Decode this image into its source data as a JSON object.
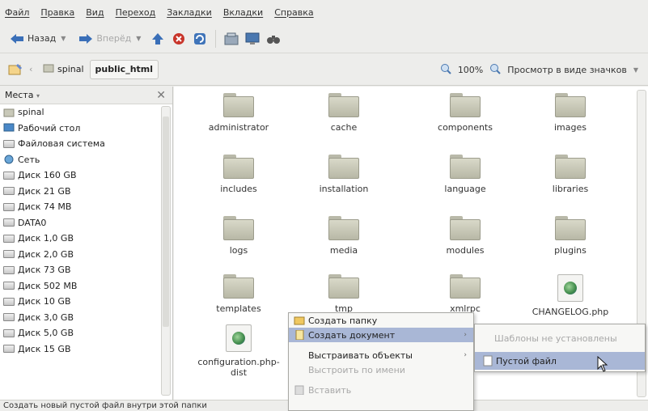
{
  "menubar": [
    "Файл",
    "Правка",
    "Вид",
    "Переход",
    "Закладки",
    "Вкладки",
    "Справка"
  ],
  "toolbar": {
    "back_label": "Назад",
    "forward_label": "Вперёд"
  },
  "location": {
    "crumbs": [
      "spinal",
      "public_html"
    ],
    "zoom": "100%",
    "view_mode": "Просмотр в виде значков"
  },
  "sidebar": {
    "title": "Места",
    "items": [
      {
        "label": "spinal",
        "icon": "home-folder-icon"
      },
      {
        "label": "Рабочий стол",
        "icon": "desktop-icon"
      },
      {
        "label": "Файловая система",
        "icon": "drive-icon"
      },
      {
        "label": "Сеть",
        "icon": "network-icon"
      },
      {
        "label": "Диск 160 GB",
        "icon": "drive-icon"
      },
      {
        "label": "Диск 21 GB",
        "icon": "drive-icon"
      },
      {
        "label": "Диск 74 MB",
        "icon": "drive-icon"
      },
      {
        "label": "DATA0",
        "icon": "drive-icon"
      },
      {
        "label": "Диск 1,0 GB",
        "icon": "drive-icon"
      },
      {
        "label": "Диск 2,0 GB",
        "icon": "drive-icon"
      },
      {
        "label": "Диск 73 GB",
        "icon": "drive-icon"
      },
      {
        "label": "Диск 502 MB",
        "icon": "drive-icon"
      },
      {
        "label": "Диск 10 GB",
        "icon": "drive-icon"
      },
      {
        "label": "Диск 3,0 GB",
        "icon": "drive-icon"
      },
      {
        "label": "Диск 5,0 GB",
        "icon": "drive-icon"
      },
      {
        "label": "Диск 15 GB",
        "icon": "drive-icon"
      }
    ]
  },
  "files": [
    {
      "name": "administrator",
      "type": "folder"
    },
    {
      "name": "cache",
      "type": "folder"
    },
    {
      "name": "components",
      "type": "folder"
    },
    {
      "name": "images",
      "type": "folder"
    },
    {
      "name": "includes",
      "type": "folder"
    },
    {
      "name": "installation",
      "type": "folder"
    },
    {
      "name": "language",
      "type": "folder"
    },
    {
      "name": "libraries",
      "type": "folder"
    },
    {
      "name": "logs",
      "type": "folder"
    },
    {
      "name": "media",
      "type": "folder"
    },
    {
      "name": "modules",
      "type": "folder"
    },
    {
      "name": "plugins",
      "type": "folder"
    },
    {
      "name": "templates",
      "type": "folder"
    },
    {
      "name": "tmp",
      "type": "folder"
    },
    {
      "name": "xmlrpc",
      "type": "folder"
    },
    {
      "name": "CHANGELOG.php",
      "type": "php"
    },
    {
      "name": "configuration.php-\ndist",
      "type": "php"
    }
  ],
  "context_menu": {
    "items": [
      {
        "label": "Создать папку",
        "state": "normal"
      },
      {
        "label": "Создать документ",
        "state": "highlighted",
        "submenu": true
      },
      {
        "label": "Выстраивать объекты",
        "state": "normal",
        "submenu": true
      },
      {
        "label": "Выстроить по имени",
        "state": "disabled"
      },
      {
        "label": "Вставить",
        "state": "disabled"
      }
    ],
    "submenu": [
      {
        "label": "Шаблоны не установлены",
        "state": "disabled"
      },
      {
        "label": "Пустой файл",
        "state": "highlighted"
      }
    ]
  },
  "status_text": "Создать новый пустой файл внутри этой папки",
  "colors": {
    "highlight": "#a9b7d6",
    "folder": "#c9c9b9"
  }
}
